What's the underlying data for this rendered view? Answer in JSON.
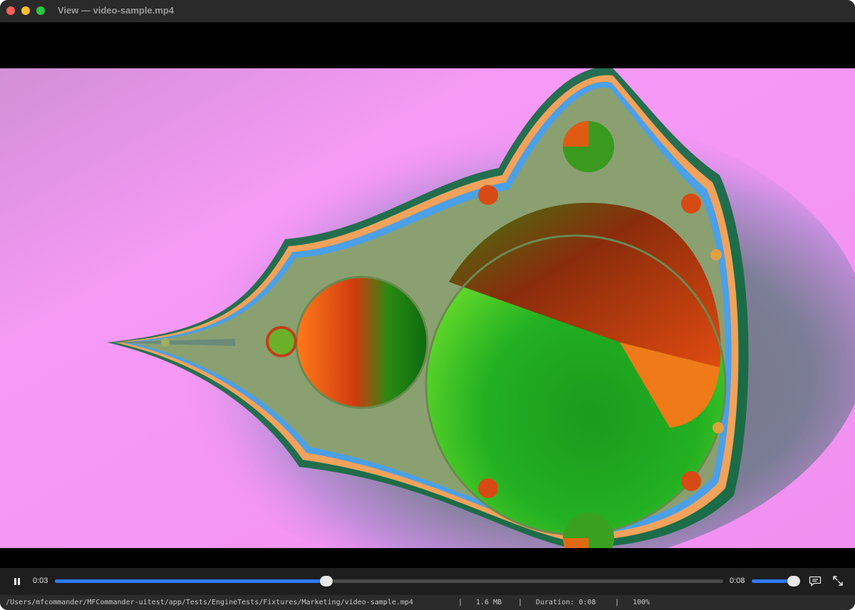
{
  "window": {
    "title": "View — video-sample.mp4"
  },
  "player": {
    "current_time": "0:03",
    "duration_time": "0:08",
    "progress_fraction": 0.406,
    "volume_fraction": 0.9,
    "pause_icon": "pause-icon",
    "subtitles_icon": "subtitles-icon",
    "fullscreen_icon": "fullscreen-icon",
    "accent_color": "#2f7bf5"
  },
  "status": {
    "path": "/Users/mfcommander/MFCommander-uitest/app/Tests/EngineTests/Fixtures/Marketing/video-sample.mp4",
    "separator": "|",
    "size": "1.6 MB",
    "duration": "Duration: 0:08",
    "zoom": "100%"
  },
  "video_frame": {
    "background_color": "#f594f5",
    "description_icon": "mandelbrot-fractal-image"
  }
}
